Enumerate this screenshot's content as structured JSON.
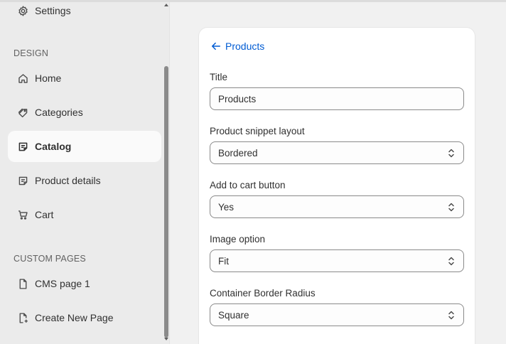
{
  "sidebar": {
    "settings": {
      "label": "Settings",
      "icon": "gear-icon"
    },
    "design_section": "DESIGN",
    "design_items": [
      {
        "label": "Home",
        "icon": "home-icon",
        "active": false
      },
      {
        "label": "Categories",
        "icon": "tag-icon",
        "active": false
      },
      {
        "label": "Catalog",
        "icon": "catalog-icon",
        "active": true
      },
      {
        "label": "Product details",
        "icon": "note-icon",
        "active": false
      },
      {
        "label": "Cart",
        "icon": "cart-icon",
        "active": false
      }
    ],
    "custom_section": "CUSTOM PAGES",
    "custom_items": [
      {
        "label": "CMS page 1",
        "icon": "page-icon"
      },
      {
        "label": "Create New Page",
        "icon": "page-add-icon"
      }
    ]
  },
  "editor": {
    "back_label": "Products",
    "fields": {
      "title": {
        "label": "Title",
        "value": "Products"
      },
      "snippet_layout": {
        "label": "Product snippet layout",
        "value": "Bordered"
      },
      "add_to_cart": {
        "label": "Add to cart button",
        "value": "Yes"
      },
      "image_option": {
        "label": "Image option",
        "value": "Fit"
      },
      "border_radius": {
        "label": "Container Border Radius",
        "value": "Square"
      }
    }
  },
  "colors": {
    "link": "#005bd3",
    "sidebar_bg": "#ebebeb",
    "active_item_bg": "#fafafa",
    "canvas_bg": "#f1f1f1"
  }
}
